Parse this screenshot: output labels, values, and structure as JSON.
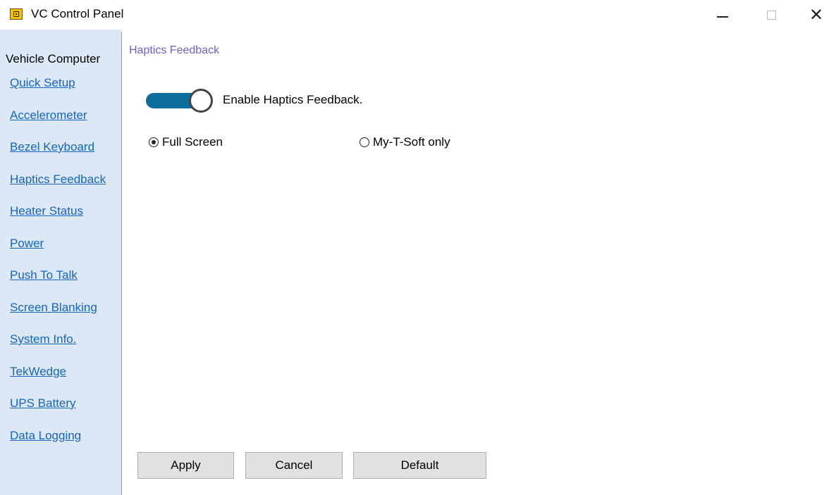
{
  "window": {
    "title": "VC Control Panel",
    "controls": [
      "minimize",
      "maximize",
      "close"
    ]
  },
  "sidebar": {
    "heading": "Vehicle Computer",
    "items": [
      {
        "label": "Quick Setup"
      },
      {
        "label": "Accelerometer"
      },
      {
        "label": "Bezel Keyboard"
      },
      {
        "label": "Haptics Feedback"
      },
      {
        "label": "Heater Status"
      },
      {
        "label": "Power"
      },
      {
        "label": "Push To Talk"
      },
      {
        "label": "Screen Blanking"
      },
      {
        "label": "System Info."
      },
      {
        "label": "TekWedge"
      },
      {
        "label": "UPS Battery"
      },
      {
        "label": "Data Logging"
      }
    ]
  },
  "main": {
    "section_title": "Haptics Feedback",
    "toggle": {
      "label": "Enable Haptics Feedback.",
      "on": true
    },
    "radios": [
      {
        "label": "Full Screen",
        "checked": true
      },
      {
        "label": "My-T-Soft only",
        "checked": false
      }
    ],
    "buttons": {
      "apply": "Apply",
      "cancel": "Cancel",
      "default": "Default"
    }
  },
  "colors": {
    "sidebar_bg": "#dde8f6",
    "link": "#1565c0",
    "section_title": "#6b63c9",
    "toggle_on": "#0b6e9c"
  }
}
